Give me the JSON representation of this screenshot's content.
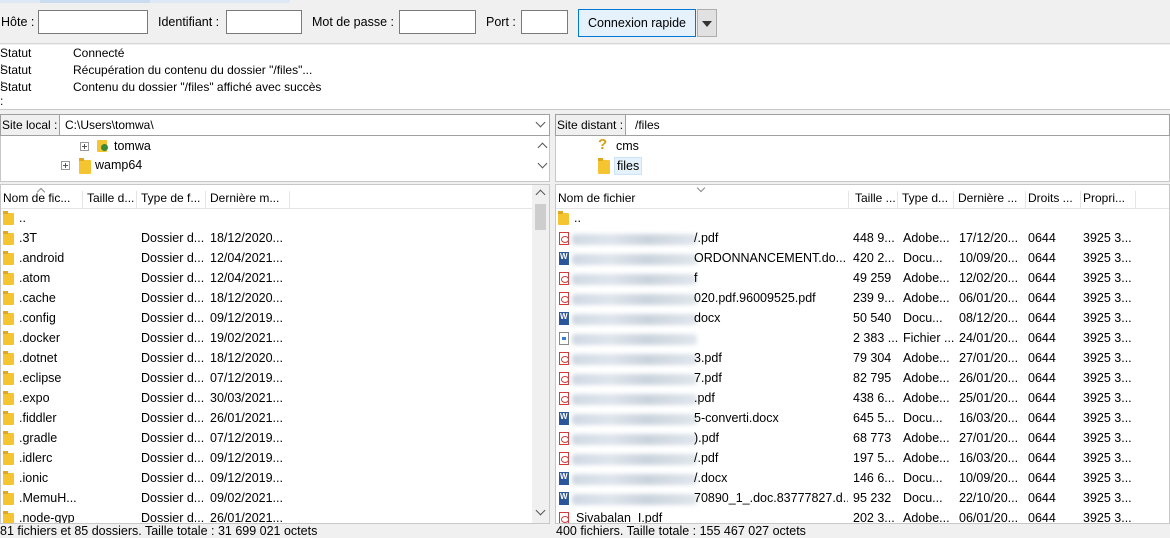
{
  "quickconnect": {
    "host_label": "Hôte :",
    "host_value": "",
    "user_label": "Identifiant :",
    "user_value": "",
    "pass_label": "Mot de passe :",
    "pass_value": "",
    "port_label": "Port :",
    "port_value": "",
    "connect_label": "Connexion rapide"
  },
  "log": [
    {
      "key": "Statut :",
      "msg": "Connecté"
    },
    {
      "key": "Statut :",
      "msg": "Récupération du contenu du dossier \"/files\"..."
    },
    {
      "key": "Statut :",
      "msg": "Contenu du dossier \"/files\" affiché avec succès"
    }
  ],
  "local": {
    "site_label": "Site local :",
    "path": "C:\\Users\\tomwa\\",
    "tree": [
      {
        "label": "tomwa",
        "icon": "user-folder-icon"
      },
      {
        "label": "wamp64",
        "icon": "folder-icon"
      }
    ],
    "columns": [
      "Nom de fic...",
      "Taille d...",
      "Type de f...",
      "Dernière m..."
    ],
    "rows": [
      {
        "name": "..",
        "size": "",
        "type": "",
        "date": ""
      },
      {
        "name": ".3T",
        "size": "",
        "type": "Dossier d...",
        "date": "18/12/2020..."
      },
      {
        "name": ".android",
        "size": "",
        "type": "Dossier d...",
        "date": "12/04/2021..."
      },
      {
        "name": ".atom",
        "size": "",
        "type": "Dossier d...",
        "date": "12/04/2021..."
      },
      {
        "name": ".cache",
        "size": "",
        "type": "Dossier d...",
        "date": "18/12/2020..."
      },
      {
        "name": ".config",
        "size": "",
        "type": "Dossier d...",
        "date": "09/12/2019..."
      },
      {
        "name": ".docker",
        "size": "",
        "type": "Dossier d...",
        "date": "19/02/2021..."
      },
      {
        "name": ".dotnet",
        "size": "",
        "type": "Dossier d...",
        "date": "18/12/2020..."
      },
      {
        "name": ".eclipse",
        "size": "",
        "type": "Dossier d...",
        "date": "07/12/2019..."
      },
      {
        "name": ".expo",
        "size": "",
        "type": "Dossier d...",
        "date": "30/03/2021..."
      },
      {
        "name": ".fiddler",
        "size": "",
        "type": "Dossier d...",
        "date": "26/01/2021..."
      },
      {
        "name": ".gradle",
        "size": "",
        "type": "Dossier d...",
        "date": "07/12/2019..."
      },
      {
        "name": ".idlerc",
        "size": "",
        "type": "Dossier d...",
        "date": "09/12/2019..."
      },
      {
        "name": ".ionic",
        "size": "",
        "type": "Dossier d...",
        "date": "09/12/2019..."
      },
      {
        "name": ".MemuH...",
        "size": "",
        "type": "Dossier d...",
        "date": "09/02/2021..."
      },
      {
        "name": ".node-gyp",
        "size": "",
        "type": "Dossier d...",
        "date": "26/01/2021..."
      }
    ],
    "status": "81 fichiers et 85 dossiers. Taille totale : 31 699 021 octets"
  },
  "remote": {
    "site_label": "Site distant :",
    "path": "/files",
    "tree": [
      {
        "label": "cms",
        "icon": "question-icon"
      },
      {
        "label": "files",
        "icon": "folder-icon"
      }
    ],
    "columns": [
      "Nom de fichier",
      "Taille ...",
      "Type d...",
      "Dernière ...",
      "Droits ...",
      "Propri..."
    ],
    "rows": [
      {
        "icon": "folder",
        "name": "..",
        "size": "",
        "type": "",
        "date": "",
        "perms": "",
        "owner": ""
      },
      {
        "icon": "pdf",
        "name": "/.pdf",
        "size": "448 9...",
        "type": "Adobe...",
        "date": "17/12/20...",
        "perms": "0644",
        "owner": "3925 3..."
      },
      {
        "icon": "doc",
        "name": "ORDONNANCEMENT.do...",
        "size": "420 2...",
        "type": "Docu...",
        "date": "10/09/20...",
        "perms": "0644",
        "owner": "3925 3..."
      },
      {
        "icon": "pdf",
        "name": "f",
        "size": "49 259",
        "type": "Adobe...",
        "date": "12/02/20...",
        "perms": "0644",
        "owner": "3925 3..."
      },
      {
        "icon": "pdf",
        "name": "020.pdf.96009525.pdf",
        "size": "239 9...",
        "type": "Adobe...",
        "date": "06/01/20...",
        "perms": "0644",
        "owner": "3925 3..."
      },
      {
        "icon": "doc",
        "name": "docx",
        "size": "50 540",
        "type": "Docu...",
        "date": "08/12/20...",
        "perms": "0644",
        "owner": "3925 3..."
      },
      {
        "icon": "gen",
        "name": "",
        "size": "2 383 ...",
        "type": "Fichier ...",
        "date": "24/01/20...",
        "perms": "0644",
        "owner": "3925 3..."
      },
      {
        "icon": "pdf",
        "name": "3.pdf",
        "size": "79 304",
        "type": "Adobe...",
        "date": "27/01/20...",
        "perms": "0644",
        "owner": "3925 3..."
      },
      {
        "icon": "pdf",
        "name": "7.pdf",
        "size": "82 795",
        "type": "Adobe...",
        "date": "26/01/20...",
        "perms": "0644",
        "owner": "3925 3..."
      },
      {
        "icon": "pdf",
        "name": ".pdf",
        "size": "438 6...",
        "type": "Adobe...",
        "date": "25/01/20...",
        "perms": "0644",
        "owner": "3925 3..."
      },
      {
        "icon": "doc",
        "name": "5-converti.docx",
        "size": "645 5...",
        "type": "Docu...",
        "date": "16/03/20...",
        "perms": "0644",
        "owner": "3925 3..."
      },
      {
        "icon": "pdf",
        "name": ").pdf",
        "size": "68 773",
        "type": "Adobe...",
        "date": "27/01/20...",
        "perms": "0644",
        "owner": "3925 3..."
      },
      {
        "icon": "pdf",
        "name": "/.pdf",
        "size": "197 5...",
        "type": "Adobe...",
        "date": "16/03/20...",
        "perms": "0644",
        "owner": "3925 3..."
      },
      {
        "icon": "doc",
        "name": "/.docx",
        "size": "146 6...",
        "type": "Docu...",
        "date": "10/09/20...",
        "perms": "0644",
        "owner": "3925 3..."
      },
      {
        "icon": "doc",
        "name": "70890_1_.doc.83777827.d...",
        "size": "95 232",
        "type": "Docu...",
        "date": "22/10/20...",
        "perms": "0644",
        "owner": "3925 3..."
      },
      {
        "icon": "pdf",
        "name": "Sivabalan_I.pdf",
        "size": "202 3...",
        "type": "Adobe...",
        "date": "06/01/20...",
        "perms": "0644",
        "owner": "3925 3..."
      }
    ],
    "status": "400 fichiers. Taille totale : 155 467 027 octets"
  }
}
